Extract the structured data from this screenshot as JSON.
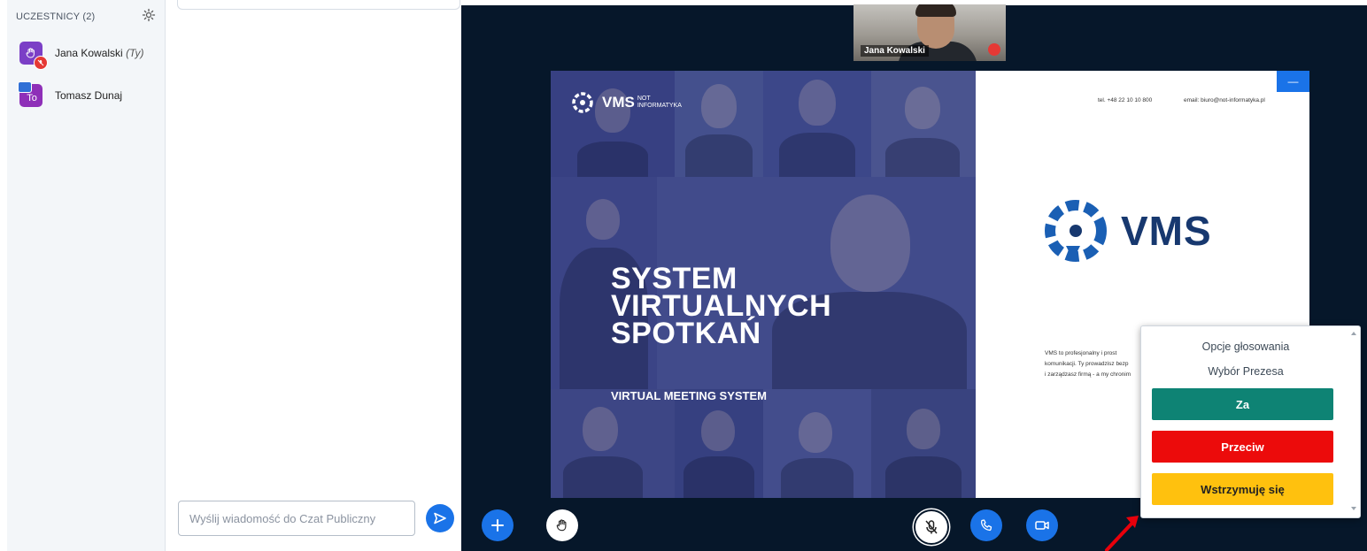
{
  "participants": {
    "header": "UCZESTNICY (2)",
    "users": [
      {
        "name": "Jana Kowalski",
        "suffix": "(Ty)",
        "avatar_color": "#7b3fc6"
      },
      {
        "name": "Tomasz Dunaj",
        "initials": "To",
        "avatar_color": "#8e2fb8"
      }
    ]
  },
  "chat": {
    "placeholder": "Wyślij wiadomość do Czat Publiczny"
  },
  "webcam": {
    "name": "Jana Kowalski"
  },
  "slide": {
    "brand": "VMS",
    "brand_sub_line1": "NOT",
    "brand_sub_line2": "INFORMATYKA",
    "title_line1": "SYSTEM",
    "title_line2": "VIRTUALNYCH",
    "title_line3": "SPOTKAŃ",
    "subtitle": "VIRTUAL MEETING SYSTEM",
    "tel": "tel. +48 22 10 10 800",
    "email": "email: biuro@not-informatyka.pl",
    "big_brand": "VMS",
    "body_line1": "VMS  to  profesjonalny  i prost",
    "body_line2": "komunikacji. Ty prowadzisz bezp",
    "body_line3": "i zarządzasz firmą - a my chronim",
    "minimize_label": "—"
  },
  "poll": {
    "title": "Opcje głosowania",
    "question": "Wybór Prezesa",
    "options": [
      {
        "label": "Za",
        "color": "#0e8374"
      },
      {
        "label": "Przeciw",
        "color": "#ec0b0b"
      },
      {
        "label": "Wstrzymuję się",
        "color": "#ffc10e"
      }
    ]
  },
  "colors": {
    "accent": "#1a73e8",
    "stage_bg": "#06172a",
    "slide_navy": "#2c3472",
    "annotation_arrow": "#e8000b"
  },
  "icons": {
    "settings": "gear-icon",
    "send": "send-icon",
    "actions": "plus-icon",
    "raise_hand": "hand-icon",
    "microphone": "mic-muted-icon",
    "phone": "phone-icon",
    "video": "video-icon"
  }
}
